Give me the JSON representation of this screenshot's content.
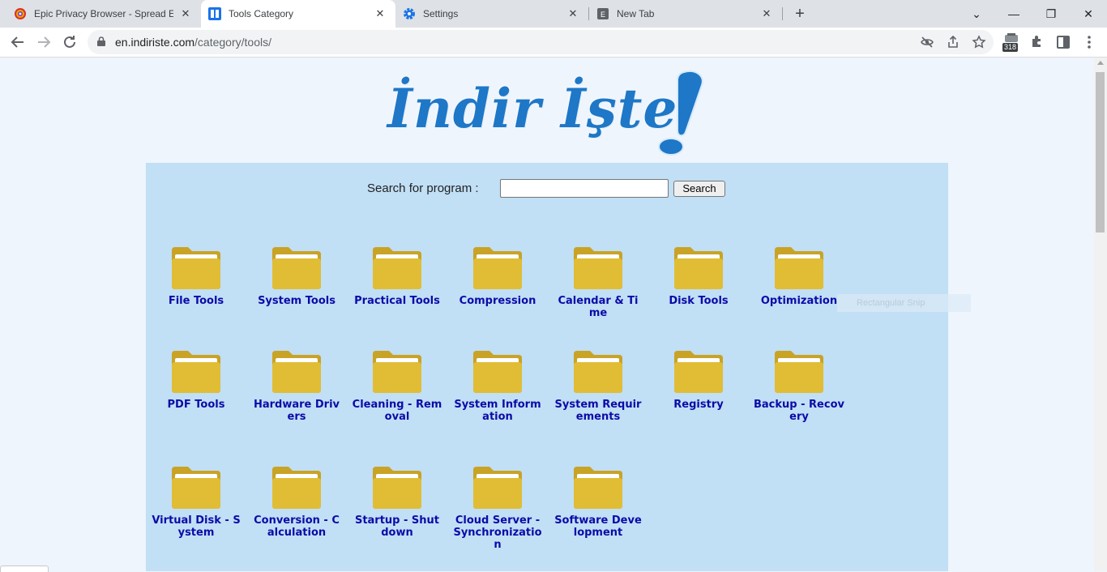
{
  "tabs": [
    {
      "title": "Epic Privacy Browser - Spread Epi",
      "icon": "epic-browser-icon",
      "active": false
    },
    {
      "title": "Tools Category",
      "icon": "site-favicon-icon",
      "active": true
    },
    {
      "title": "Settings",
      "icon": "gear-icon",
      "active": false
    },
    {
      "title": "New Tab",
      "icon": "page-icon",
      "active": false
    }
  ],
  "favicon_letter": "E",
  "window_controls": {
    "tab_search": "⌄",
    "minimize": "—",
    "restore": "❐",
    "close": "✕"
  },
  "toolbar": {
    "url_host": "en.indiriste.com",
    "url_path": "/category/tools/",
    "extension_badge": "318"
  },
  "logo": {
    "text": "İndir İşte",
    "exclaim": "!"
  },
  "search": {
    "label": "Search for program :",
    "value": "",
    "button": "Search"
  },
  "categories": [
    "File Tools",
    "System Tools",
    "Practical Tools",
    "Compression",
    "Calendar & Time",
    "Disk Tools",
    "Optimization",
    "PDF Tools",
    "Hardware Drivers",
    "Cleaning - Removal",
    "System Information",
    "System Requirements",
    "Registry",
    "Backup - Recovery",
    "Virtual Disk - System",
    "Conversion - Calculation",
    "Startup - Shutdown",
    "Cloud Server - Synchronization",
    "Software Development"
  ],
  "overlay_text": "Rectangular Snip",
  "colors": {
    "accent": "#1a73e8",
    "link": "#0b0ba8",
    "logo": "#1e77c7",
    "panel": "#c1dff5",
    "folder": "#e0bd35"
  }
}
